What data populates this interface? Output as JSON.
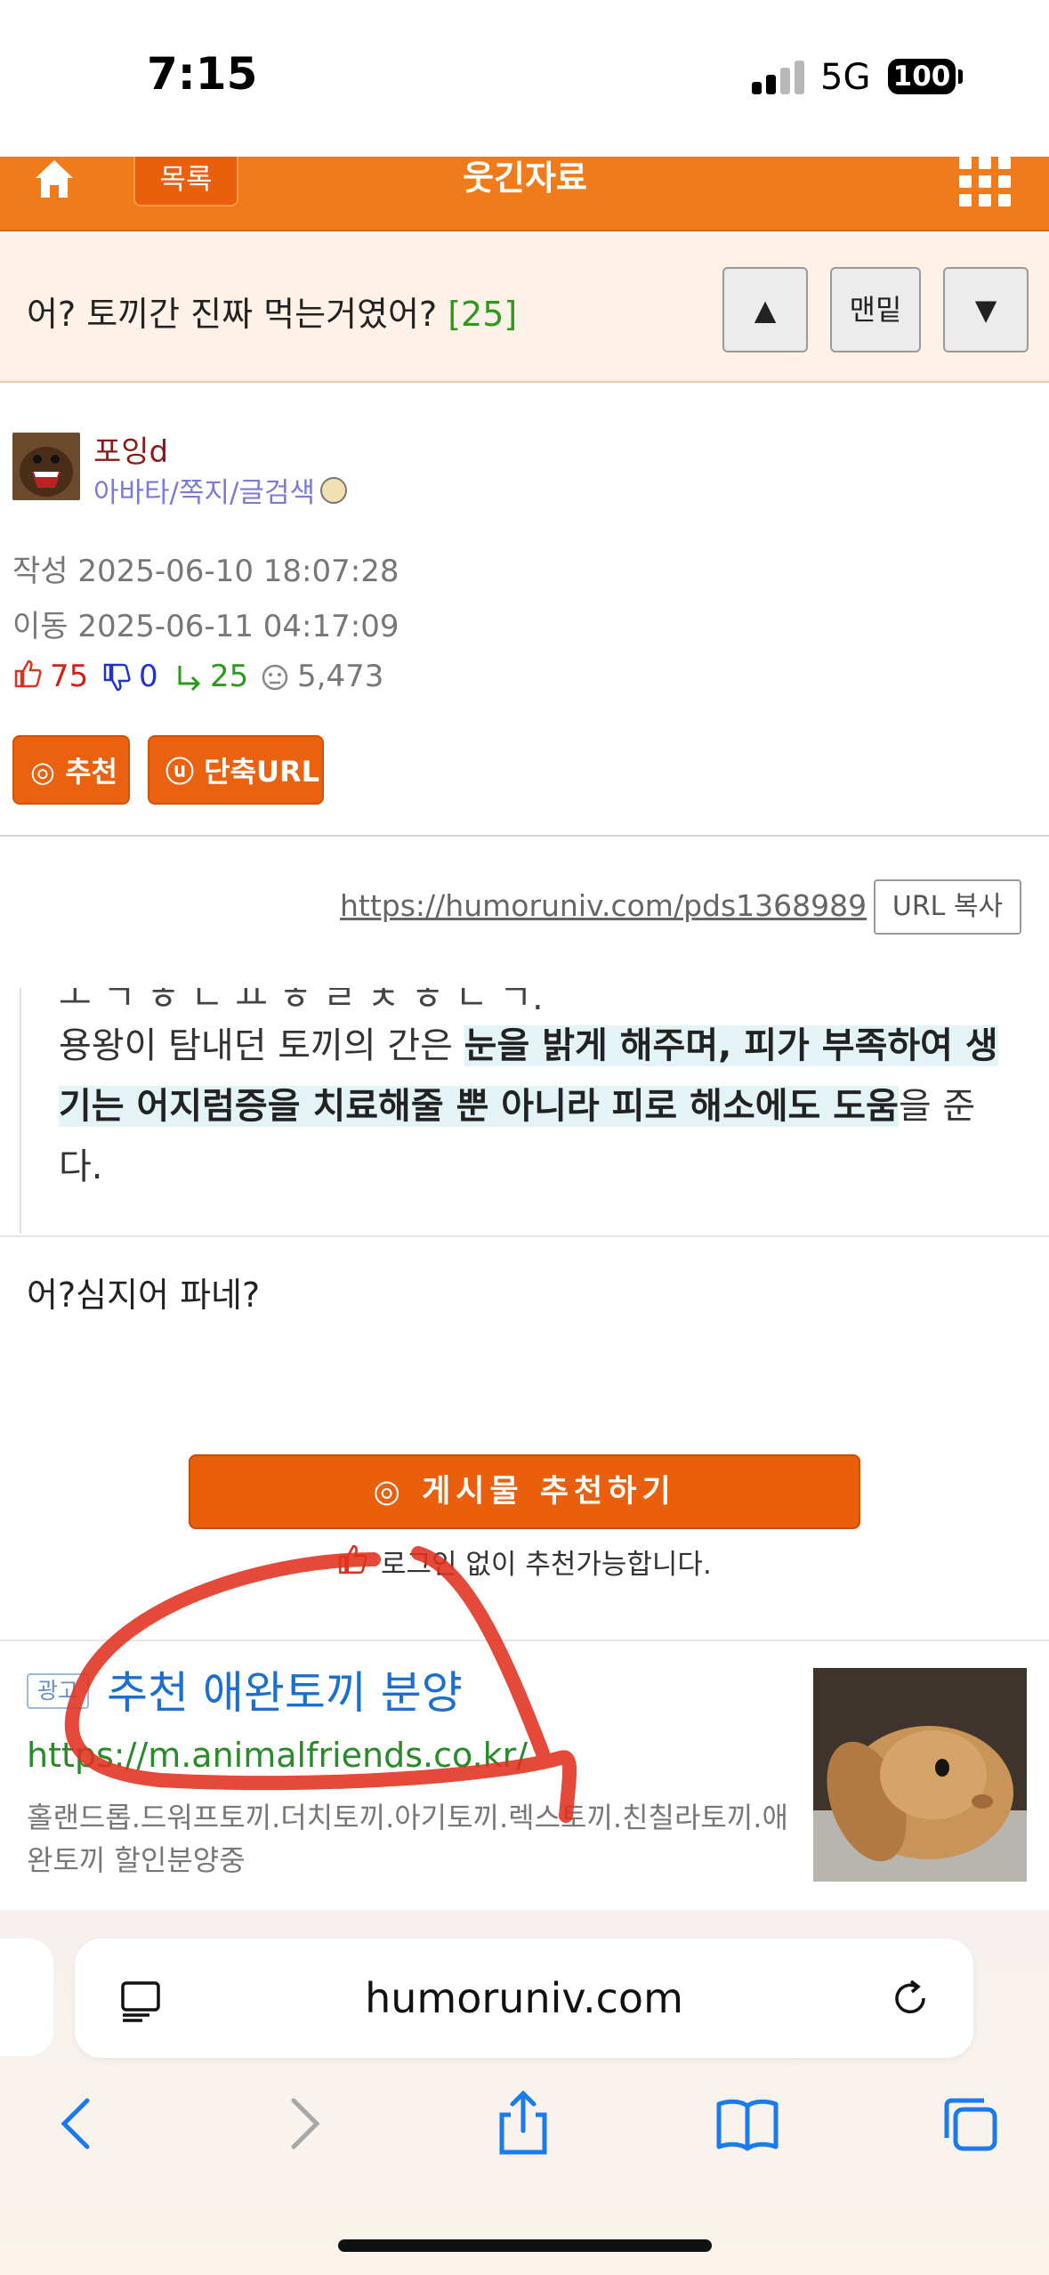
{
  "status_bar": {
    "time": "7:15",
    "network": "5G",
    "battery": "100"
  },
  "nav": {
    "list_label": "목록",
    "board_title": "웃긴자료"
  },
  "post": {
    "title": "어? 토끼간 진짜 먹는거였어?",
    "comment_count": "[25]",
    "up_label": "▲",
    "bottom_label": "맨밑",
    "down_label": "▼"
  },
  "author": {
    "name": "포잉d",
    "links": "아바타/쪽지/글검색"
  },
  "meta": {
    "written": "작성 2025-06-10 18:07:28",
    "moved": "이동 2025-06-11 04:17:09",
    "likes": "75",
    "dislikes": "0",
    "replies": "25",
    "views": "5,473"
  },
  "actions": {
    "recommend": "추천",
    "short_url": "단축URL"
  },
  "url": {
    "link": "https://humoruniv.com/pds1368989",
    "copy_label": "URL 복사"
  },
  "quote": {
    "line1_plain": "용왕이 탐내던 토끼의 간은 ",
    "line1_hl": "눈을 밝게 해주며, 피가 부족하여 생",
    "line2_hl": "기는 어지럼증을 치료해줄 뿐 아니라 피로 해소에도 도움",
    "line2_plain": "을 준",
    "line3_plain": "다."
  },
  "comment": "어?심지어 파네?",
  "recommend": {
    "button": "게시물 추천하기",
    "note": "로그인 없이 추천가능합니다."
  },
  "ad": {
    "tag": "광고",
    "title": "추천 애완토끼 분양",
    "url": "https://m.animalfriends.co.kr/",
    "desc": "홀랜드롭.드워프토끼.더치토끼.아기토끼.렉스토끼.친칠라토끼.애완토끼 할인분양중"
  },
  "browser": {
    "domain": "humoruniv.com"
  },
  "colors": {
    "accent": "#f07b1b",
    "annotation": "#e0301e"
  }
}
